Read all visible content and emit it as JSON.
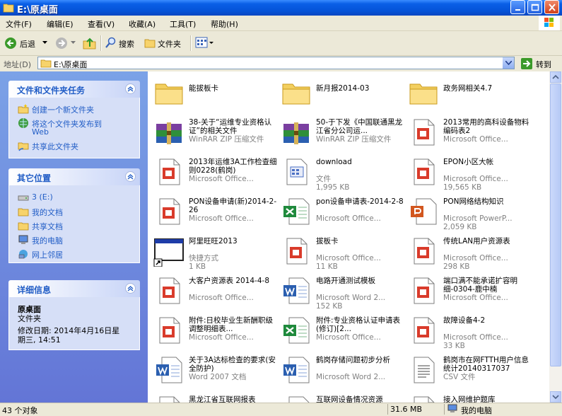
{
  "window": {
    "title": "E:\\原桌面"
  },
  "menu": [
    "文件(F)",
    "编辑(E)",
    "查看(V)",
    "收藏(A)",
    "工具(T)",
    "帮助(H)"
  ],
  "toolbar": {
    "back": "后退",
    "search": "搜索",
    "folders": "文件夹"
  },
  "address": {
    "label": "地址(D)",
    "value": "E:\\原桌面",
    "go": "转到"
  },
  "tasks_panel": {
    "title": "文件和文件夹任务",
    "links": [
      "创建一个新文件夹",
      "将这个文件夹发布到",
      "Web",
      "共享此文件夹"
    ]
  },
  "places_panel": {
    "title": "其它位置",
    "links": [
      "3 (E:)",
      "我的文档",
      "共享文档",
      "我的电脑",
      "网上邻居"
    ]
  },
  "details_panel": {
    "title": "详细信息",
    "name": "原桌面",
    "type": "文件夹",
    "modified_line1": "修改日期: 2014年4月16日星",
    "modified_line2": "期三, 14:51"
  },
  "files": [
    {
      "name": "能拔板卡",
      "meta1": "",
      "meta2": "",
      "icon": "folder-icon"
    },
    {
      "name": "新月报2014-03",
      "meta1": "",
      "meta2": "",
      "icon": "folder-icon"
    },
    {
      "name": "政务网相关4.7",
      "meta1": "",
      "meta2": "",
      "icon": "folder-icon"
    },
    {
      "name": "38-关于“运维专业资格认证”的相关文件",
      "meta1": "WinRAR ZIP 压缩文件",
      "meta2": "",
      "icon": "winrar-icon"
    },
    {
      "name": "50-于下发《中国联通黑龙江省分公司运...",
      "meta1": "WinRAR ZIP 压缩文件",
      "meta2": "",
      "icon": "winrar-icon"
    },
    {
      "name": "2013常用的高科设备物料编码表2",
      "meta1": "Microsoft Office...",
      "meta2": "",
      "icon": "office-doc-icon"
    },
    {
      "name": "2013年运维3A工作检查细则0228(鹤岗)",
      "meta1": "Microsoft Office...",
      "meta2": "",
      "icon": "office-doc-icon"
    },
    {
      "name": "download",
      "meta1": "文件",
      "meta2": "1,995 KB",
      "icon": "generic-file-icon"
    },
    {
      "name": "EPON小区大帐",
      "meta1": "Microsoft Office...",
      "meta2": "19,565 KB",
      "icon": "office-doc-icon"
    },
    {
      "name": "PON设备申请(新)2014-2-26",
      "meta1": "Microsoft Office...",
      "meta2": "",
      "icon": "office-doc-icon"
    },
    {
      "name": "pon设备申请表-2014-2-8",
      "meta1": "Microsoft Office...",
      "meta2": "",
      "icon": "excel-icon"
    },
    {
      "name": "PON网络结构知识",
      "meta1": "Microsoft PowerP...",
      "meta2": "2,059 KB",
      "icon": "powerpoint-icon"
    },
    {
      "name": "阿里旺旺2013",
      "meta1": "快捷方式",
      "meta2": "1 KB",
      "icon": "shortcut-icon"
    },
    {
      "name": "拔板卡",
      "meta1": "Microsoft Office...",
      "meta2": "11 KB",
      "icon": "office-doc-icon"
    },
    {
      "name": "传统LAN用户资源表",
      "meta1": "Microsoft Office...",
      "meta2": "298 KB",
      "icon": "office-doc-icon"
    },
    {
      "name": "大客户资源表 2014-4-8",
      "meta1": "Microsoft Office...",
      "meta2": "",
      "icon": "office-doc-icon"
    },
    {
      "name": "电路开通测试模板",
      "meta1": "Microsoft Word 2...",
      "meta2": "152 KB",
      "icon": "word-icon"
    },
    {
      "name": "端口满不能承诺扩容明细-0304-鹿中楠",
      "meta1": "Microsoft Office...",
      "meta2": "",
      "icon": "office-doc-icon"
    },
    {
      "name": "附件:日校毕业生新酬职级调整明细表...",
      "meta1": "Microsoft Office...",
      "meta2": "",
      "icon": "office-doc-icon"
    },
    {
      "name": "附件:专业资格认证申请表(修订)[2...",
      "meta1": "Microsoft Office...",
      "meta2": "",
      "icon": "excel-icon"
    },
    {
      "name": "故障设备4-2",
      "meta1": "Microsoft Office...",
      "meta2": "33 KB",
      "icon": "office-doc-icon"
    },
    {
      "name": "关于3A达标检查的要求(安全防护)",
      "meta1": "Word 2007 文档",
      "meta2": "",
      "icon": "word-icon"
    },
    {
      "name": "鹤岗存储问题初步分析",
      "meta1": "Microsoft Word 2...",
      "meta2": "",
      "icon": "word-icon"
    },
    {
      "name": "鹤岗市在网FTTH用户信息统计20140317037",
      "meta1": "CSV 文件",
      "meta2": "",
      "icon": "csv-icon"
    },
    {
      "name": "黑龙江省互联网报表",
      "meta1": "",
      "meta2": "",
      "icon": "office-doc-icon"
    },
    {
      "name": "互联网设备情况资源",
      "meta1": "",
      "meta2": "",
      "icon": "excel-icon"
    },
    {
      "name": "接入网维护题库",
      "meta1": "",
      "meta2": "",
      "icon": "office-doc-icon"
    }
  ],
  "status": {
    "count": "43 个对象",
    "size": "31.6 MB",
    "location": "我的电脑"
  }
}
